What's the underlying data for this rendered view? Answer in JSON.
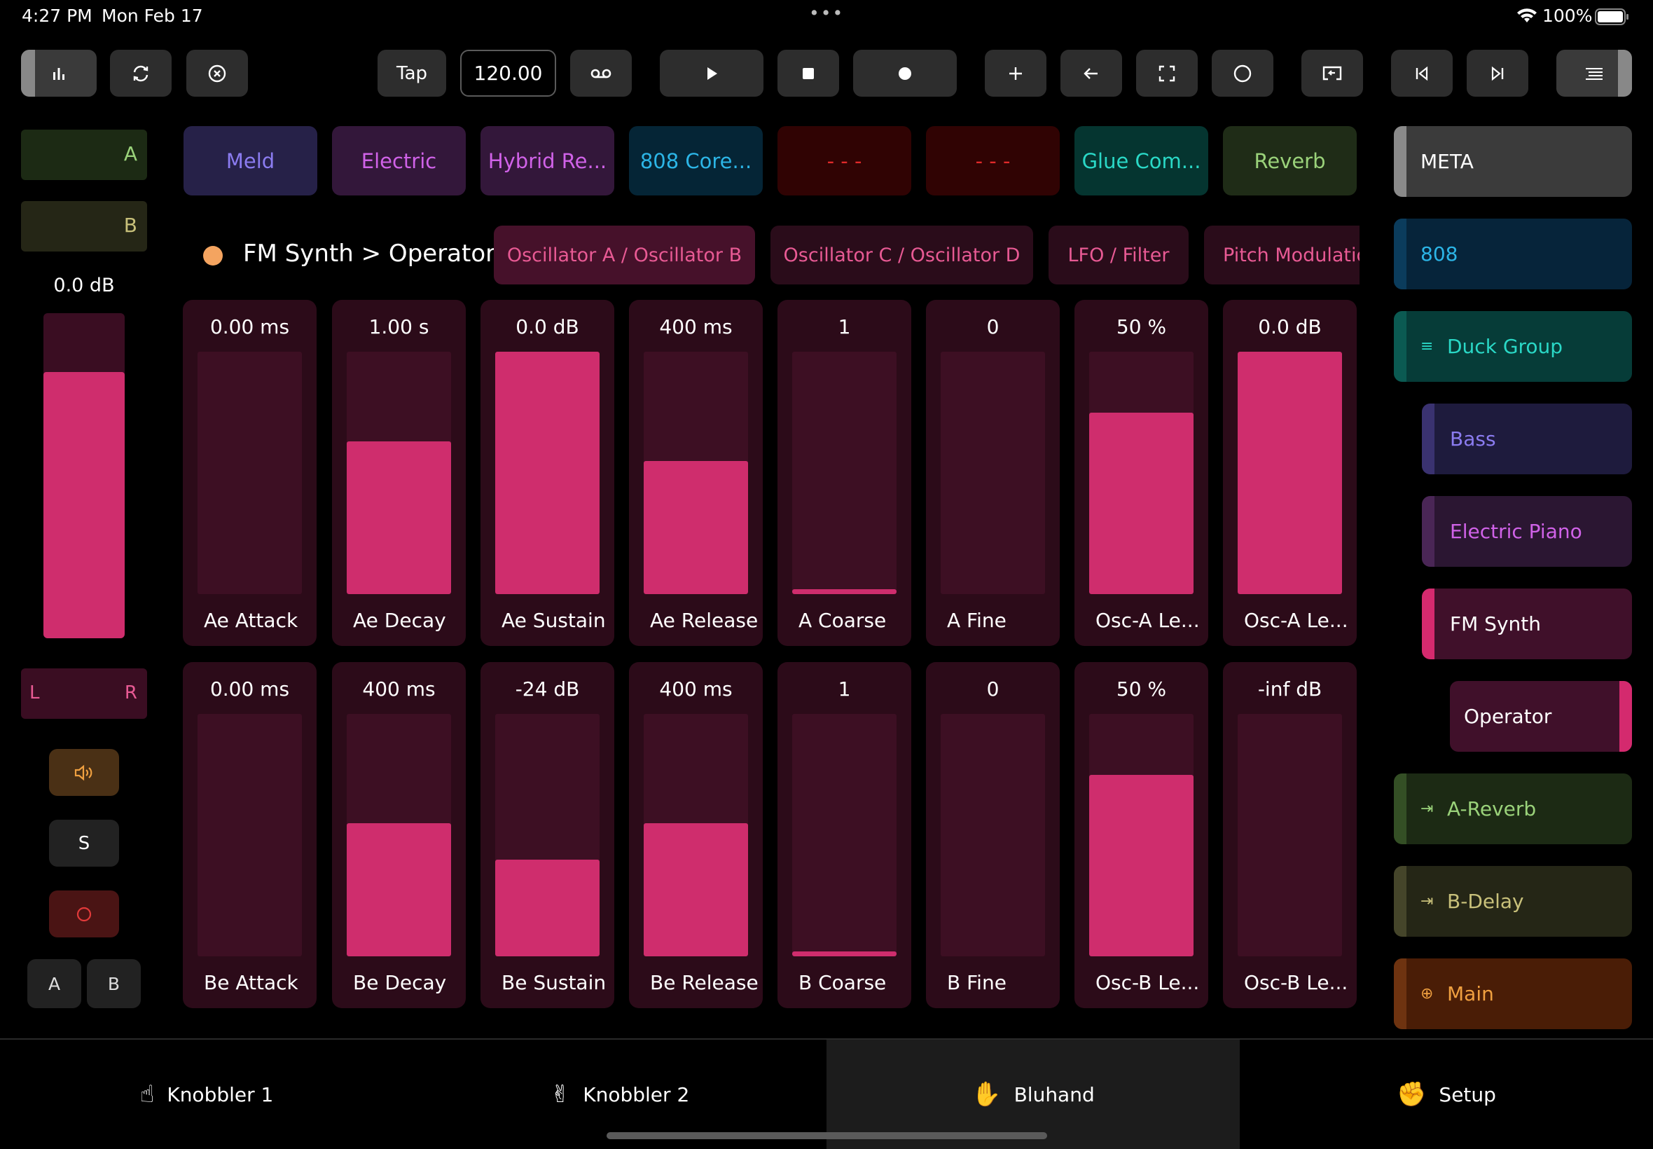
{
  "status": {
    "time": "4:27 PM",
    "date": "Mon Feb 17",
    "dots": "•••",
    "battery": "100%"
  },
  "toolbar": {
    "tap": "Tap",
    "tempo": "120.00"
  },
  "left": {
    "slot_a": "A",
    "slot_b": "B",
    "volume": "0.0 dB",
    "volume_level": 0.82,
    "pan_left": "L",
    "pan_right": "R",
    "solo": "S",
    "ab_a": "A",
    "ab_b": "B"
  },
  "devices": [
    {
      "label": "Meld",
      "bg": "#262148",
      "fg": "#8b7cf0"
    },
    {
      "label": "Electric",
      "bg": "#33173a",
      "fg": "#d062e8"
    },
    {
      "label": "Hybrid Re...",
      "bg": "#33173a",
      "fg": "#d062e8"
    },
    {
      "label": "808 Core...",
      "bg": "#052536",
      "fg": "#2cb5e6"
    },
    {
      "label": "- - -",
      "bg": "#300303",
      "fg": "#e02a2a"
    },
    {
      "label": "- - -",
      "bg": "#300303",
      "fg": "#e02a2a"
    },
    {
      "label": "Glue Com...",
      "bg": "#053530",
      "fg": "#2ad8c6"
    },
    {
      "label": "Reverb",
      "bg": "#1f2c17",
      "fg": "#9ad27a"
    }
  ],
  "breadcrumb": "FM Synth > Operator",
  "param_tabs": [
    {
      "label": "Oscillator A / Oscillator B"
    },
    {
      "label": "Oscillator C / Oscillator D"
    },
    {
      "label": "LFO / Filter"
    },
    {
      "label": "Pitch Modulatio"
    }
  ],
  "params": [
    {
      "value": "0.00 ms",
      "label": "Ae Attack",
      "level": 0
    },
    {
      "value": "1.00 s",
      "label": "Ae Decay",
      "level": 0.63
    },
    {
      "value": "0.0 dB",
      "label": "Ae Sustain",
      "level": 1
    },
    {
      "value": "400 ms",
      "label": "Ae Release",
      "level": 0.55
    },
    {
      "value": "1",
      "label": "A Coarse",
      "level": 0.02
    },
    {
      "value": "0",
      "label": "A Fine",
      "level": 0
    },
    {
      "value": "50 %",
      "label": "Osc-A Le...",
      "level": 0.75
    },
    {
      "value": "0.0 dB",
      "label": "Osc-A Le...",
      "level": 1
    },
    {
      "value": "0.00 ms",
      "label": "Be Attack",
      "level": 0
    },
    {
      "value": "400 ms",
      "label": "Be Decay",
      "level": 0.55
    },
    {
      "value": "-24 dB",
      "label": "Be Sustain",
      "level": 0.4
    },
    {
      "value": "400 ms",
      "label": "Be Release",
      "level": 0.55
    },
    {
      "value": "1",
      "label": "B Coarse",
      "level": 0.02
    },
    {
      "value": "0",
      "label": "B Fine",
      "level": 0
    },
    {
      "value": "50 %",
      "label": "Osc-B Le...",
      "level": 0.75
    },
    {
      "value": "-inf dB",
      "label": "Osc-B Le...",
      "level": 0
    }
  ],
  "tracks": [
    {
      "label": "META",
      "bg": "#3b3b3b",
      "fg": "#ffffff",
      "bar": "#8a8a8a",
      "icon": ""
    },
    {
      "label": "808",
      "bg": "#06243a",
      "fg": "#2cb5e6",
      "bar": "#0b3c5c",
      "icon": ""
    },
    {
      "label": "Duck Group",
      "bg": "#063c38",
      "fg": "#2ad8c6",
      "bar": "#0b5a52",
      "icon": "≡"
    },
    {
      "label": "Bass",
      "bg": "#1e1b3d",
      "fg": "#8b7cf0",
      "bar": "#3a3270",
      "icon": ""
    },
    {
      "label": "Electric Piano",
      "bg": "#2b1632",
      "fg": "#d062e8",
      "bar": "#4a2656",
      "icon": ""
    },
    {
      "label": "FM Synth",
      "bg": "#40102a",
      "fg": "#ffffff",
      "bar": "#d42a6e",
      "icon": ""
    },
    {
      "label": "Operator",
      "bg": "#40102a",
      "fg": "#ffffff",
      "bar": "#d42a6e",
      "icon": ""
    },
    {
      "label": "A-Reverb",
      "bg": "#1c2a14",
      "fg": "#9ad27a",
      "bar": "#344f25",
      "icon": "⇥"
    },
    {
      "label": "B-Delay",
      "bg": "#252616",
      "fg": "#c8c07a",
      "bar": "#45452a",
      "icon": "⇥"
    },
    {
      "label": "Main",
      "bg": "#4a1d06",
      "fg": "#f0a040",
      "bar": "#6e3310",
      "icon": "⊕"
    }
  ],
  "bottom_tabs": [
    {
      "label": "Knobbler 1",
      "icon": "☝"
    },
    {
      "label": "Knobbler 2",
      "icon": "✌"
    },
    {
      "label": "Bluhand",
      "icon": "✋"
    },
    {
      "label": "Setup",
      "icon": "✊"
    }
  ]
}
